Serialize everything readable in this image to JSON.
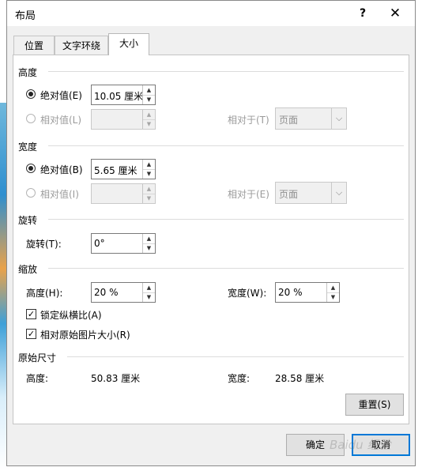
{
  "window": {
    "title": "布局",
    "help": "?",
    "close": "✕"
  },
  "tabs": [
    {
      "label": "位置"
    },
    {
      "label": "文字环绕"
    },
    {
      "label": "大小"
    }
  ],
  "height": {
    "title": "高度",
    "absolute_label": "绝对值(E)",
    "absolute_value": "10.05 厘米",
    "relative_label": "相对值(L)",
    "relative_value": "",
    "relative_to_label": "相对于(T)",
    "relative_to_value": "页面"
  },
  "width": {
    "title": "宽度",
    "absolute_label": "绝对值(B)",
    "absolute_value": "5.65 厘米",
    "relative_label": "相对值(I)",
    "relative_value": "",
    "relative_to_label": "相对于(E)",
    "relative_to_value": "页面"
  },
  "rotation": {
    "title": "旋转",
    "label": "旋转(T):",
    "value": "0°"
  },
  "scale": {
    "title": "缩放",
    "height_label": "高度(H):",
    "height_value": "20 %",
    "width_label": "宽度(W):",
    "width_value": "20 %",
    "lock_aspect_label": "锁定纵横比(A)",
    "lock_aspect_checked": true,
    "relative_original_label": "相对原始图片大小(R)",
    "relative_original_checked": true,
    "check_mark": "✓"
  },
  "original_size": {
    "title": "原始尺寸",
    "height_label": "高度:",
    "height_value": "50.83 厘米",
    "width_label": "宽度:",
    "width_value": "28.58 厘米"
  },
  "buttons": {
    "reset": "重置(S)",
    "ok": "确定",
    "cancel": "取消"
  },
  "watermark": "Baidu 经验",
  "icons": {
    "spin_up": "▲",
    "spin_down": "▼",
    "dropdown": "⌵"
  }
}
